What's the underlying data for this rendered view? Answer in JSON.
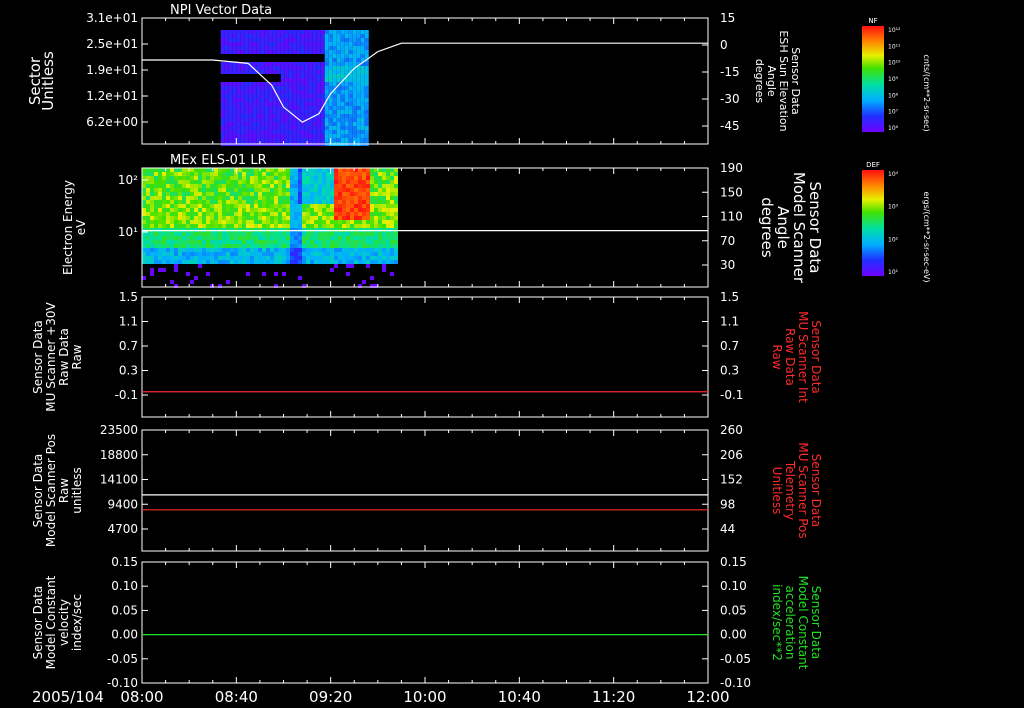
{
  "chart_data": [
    {
      "type": "heatmap",
      "title": "NPI Vector Data",
      "ylabel_left": [
        "Sector",
        "Unitless"
      ],
      "yticks_left": [
        "3.1e+01",
        "2.5e+01",
        "1.9e+01",
        "1.2e+01",
        "6.2e+00"
      ],
      "ylabel_right": [
        "Sensor Data",
        "ESH Sun Elevation",
        "Angle",
        "degrees"
      ],
      "yticks_right": [
        "15",
        "0",
        "-15",
        "-30",
        "-45"
      ],
      "ylim_right": [
        -60,
        15
      ],
      "data_span": [
        "08:30",
        "09:35"
      ],
      "series": [
        {
          "x": [
            "08:00",
            "08:30",
            "08:45",
            "08:55",
            "09:00",
            "09:08",
            "09:15",
            "09:20",
            "09:30",
            "09:40",
            "09:50",
            "12:00"
          ],
          "values": [
            -10,
            -10,
            -12,
            -25,
            -38,
            -47,
            -42,
            -30,
            -15,
            -5,
            0,
            0
          ]
        }
      ],
      "colorbar": {
        "title": "NF",
        "unit": "cnts/(cm**2-sr-sec)",
        "ticks": [
          "10¹²",
          "10¹¹",
          "10¹⁰",
          "10⁹",
          "10⁸",
          "10⁷",
          "10⁶"
        ]
      }
    },
    {
      "type": "heatmap",
      "title": "MEx ELS-01 LR",
      "ylabel_left": [
        "Electron Energy",
        "eV"
      ],
      "yticks_left": [
        "10²",
        "10¹"
      ],
      "ylabel_right": [
        "Sensor Data",
        "Model Scanner",
        "Angle",
        "degrees"
      ],
      "yticks_right": [
        "190",
        "150",
        "110",
        "70",
        "30"
      ],
      "ylim_right": [
        0,
        190
      ],
      "data_span": [
        "08:00",
        "09:48"
      ],
      "series": [
        {
          "x": [
            "08:00",
            "12:00"
          ],
          "values": [
            90,
            90
          ]
        }
      ],
      "colorbar": {
        "title": "DEF",
        "unit": "ergs/(cm**2-sr-sec-eV)",
        "ticks": [
          "10⁴",
          "10³",
          "10²",
          "10¹"
        ]
      }
    },
    {
      "type": "line",
      "ylabel_left": [
        "Sensor Data",
        "MU Scanner +30V",
        "Raw Data",
        "Raw"
      ],
      "yticks_left": [
        "1.5",
        "1.1",
        "0.7",
        "0.3",
        "-0.1"
      ],
      "ylabel_right": [
        "Sensor Data",
        "MU Scanner Int",
        "Raw Data",
        "Raw"
      ],
      "yticks_right": [
        "1.5",
        "1.1",
        "0.7",
        "0.3",
        "-0.1"
      ],
      "ylim": [
        -0.4,
        1.5
      ],
      "series": [
        {
          "x": [
            "08:00",
            "12:00"
          ],
          "values": [
            0,
            0
          ],
          "color": "#ff2a2a"
        }
      ]
    },
    {
      "type": "line",
      "ylabel_left": [
        "Sensor Data",
        "Model Scanner Pos",
        "Raw",
        "unitless"
      ],
      "yticks_left": [
        "23500",
        "18800",
        "14100",
        "9400",
        "4700"
      ],
      "ylabel_right": [
        "Sensor Data",
        "MU Scanner Pos",
        "Telemetry",
        "Unitless"
      ],
      "yticks_right": [
        "260",
        "206",
        "152",
        "98",
        "44"
      ],
      "ylim": [
        0,
        23500
      ],
      "series": [
        {
          "x": [
            "08:00",
            "12:00"
          ],
          "values": [
            10900,
            10900
          ],
          "color": "#ffffff"
        },
        {
          "x": [
            "08:00",
            "12:00"
          ],
          "values": [
            8000,
            8000
          ],
          "color": "#ff2a2a"
        }
      ]
    },
    {
      "type": "line",
      "ylabel_left": [
        "Sensor Data",
        "Model Constant",
        "velocity",
        "index/sec"
      ],
      "yticks_left": [
        "0.15",
        "0.10",
        "0.05",
        "0.00",
        "-0.05",
        "-0.10"
      ],
      "ylabel_right": [
        "Sensor Data",
        "Model Constant",
        "acceleration",
        "index/sec**2"
      ],
      "yticks_right": [
        "0.15",
        "0.10",
        "0.05",
        "0.00",
        "-0.05",
        "-0.10"
      ],
      "ylim": [
        -0.1,
        0.15
      ],
      "series": [
        {
          "x": [
            "08:00",
            "12:00"
          ],
          "values": [
            0,
            0
          ],
          "color": "#22e022"
        }
      ]
    }
  ],
  "x_axis": {
    "date_label": "2005/104",
    "ticks": [
      "08:00",
      "08:40",
      "09:20",
      "10:00",
      "10:40",
      "11:20",
      "12:00"
    ],
    "range": [
      "08:00",
      "12:00"
    ]
  },
  "colors": {
    "background": "#000000",
    "axes": "#ffffff",
    "red": "#ff2a2a",
    "green": "#22e022"
  }
}
